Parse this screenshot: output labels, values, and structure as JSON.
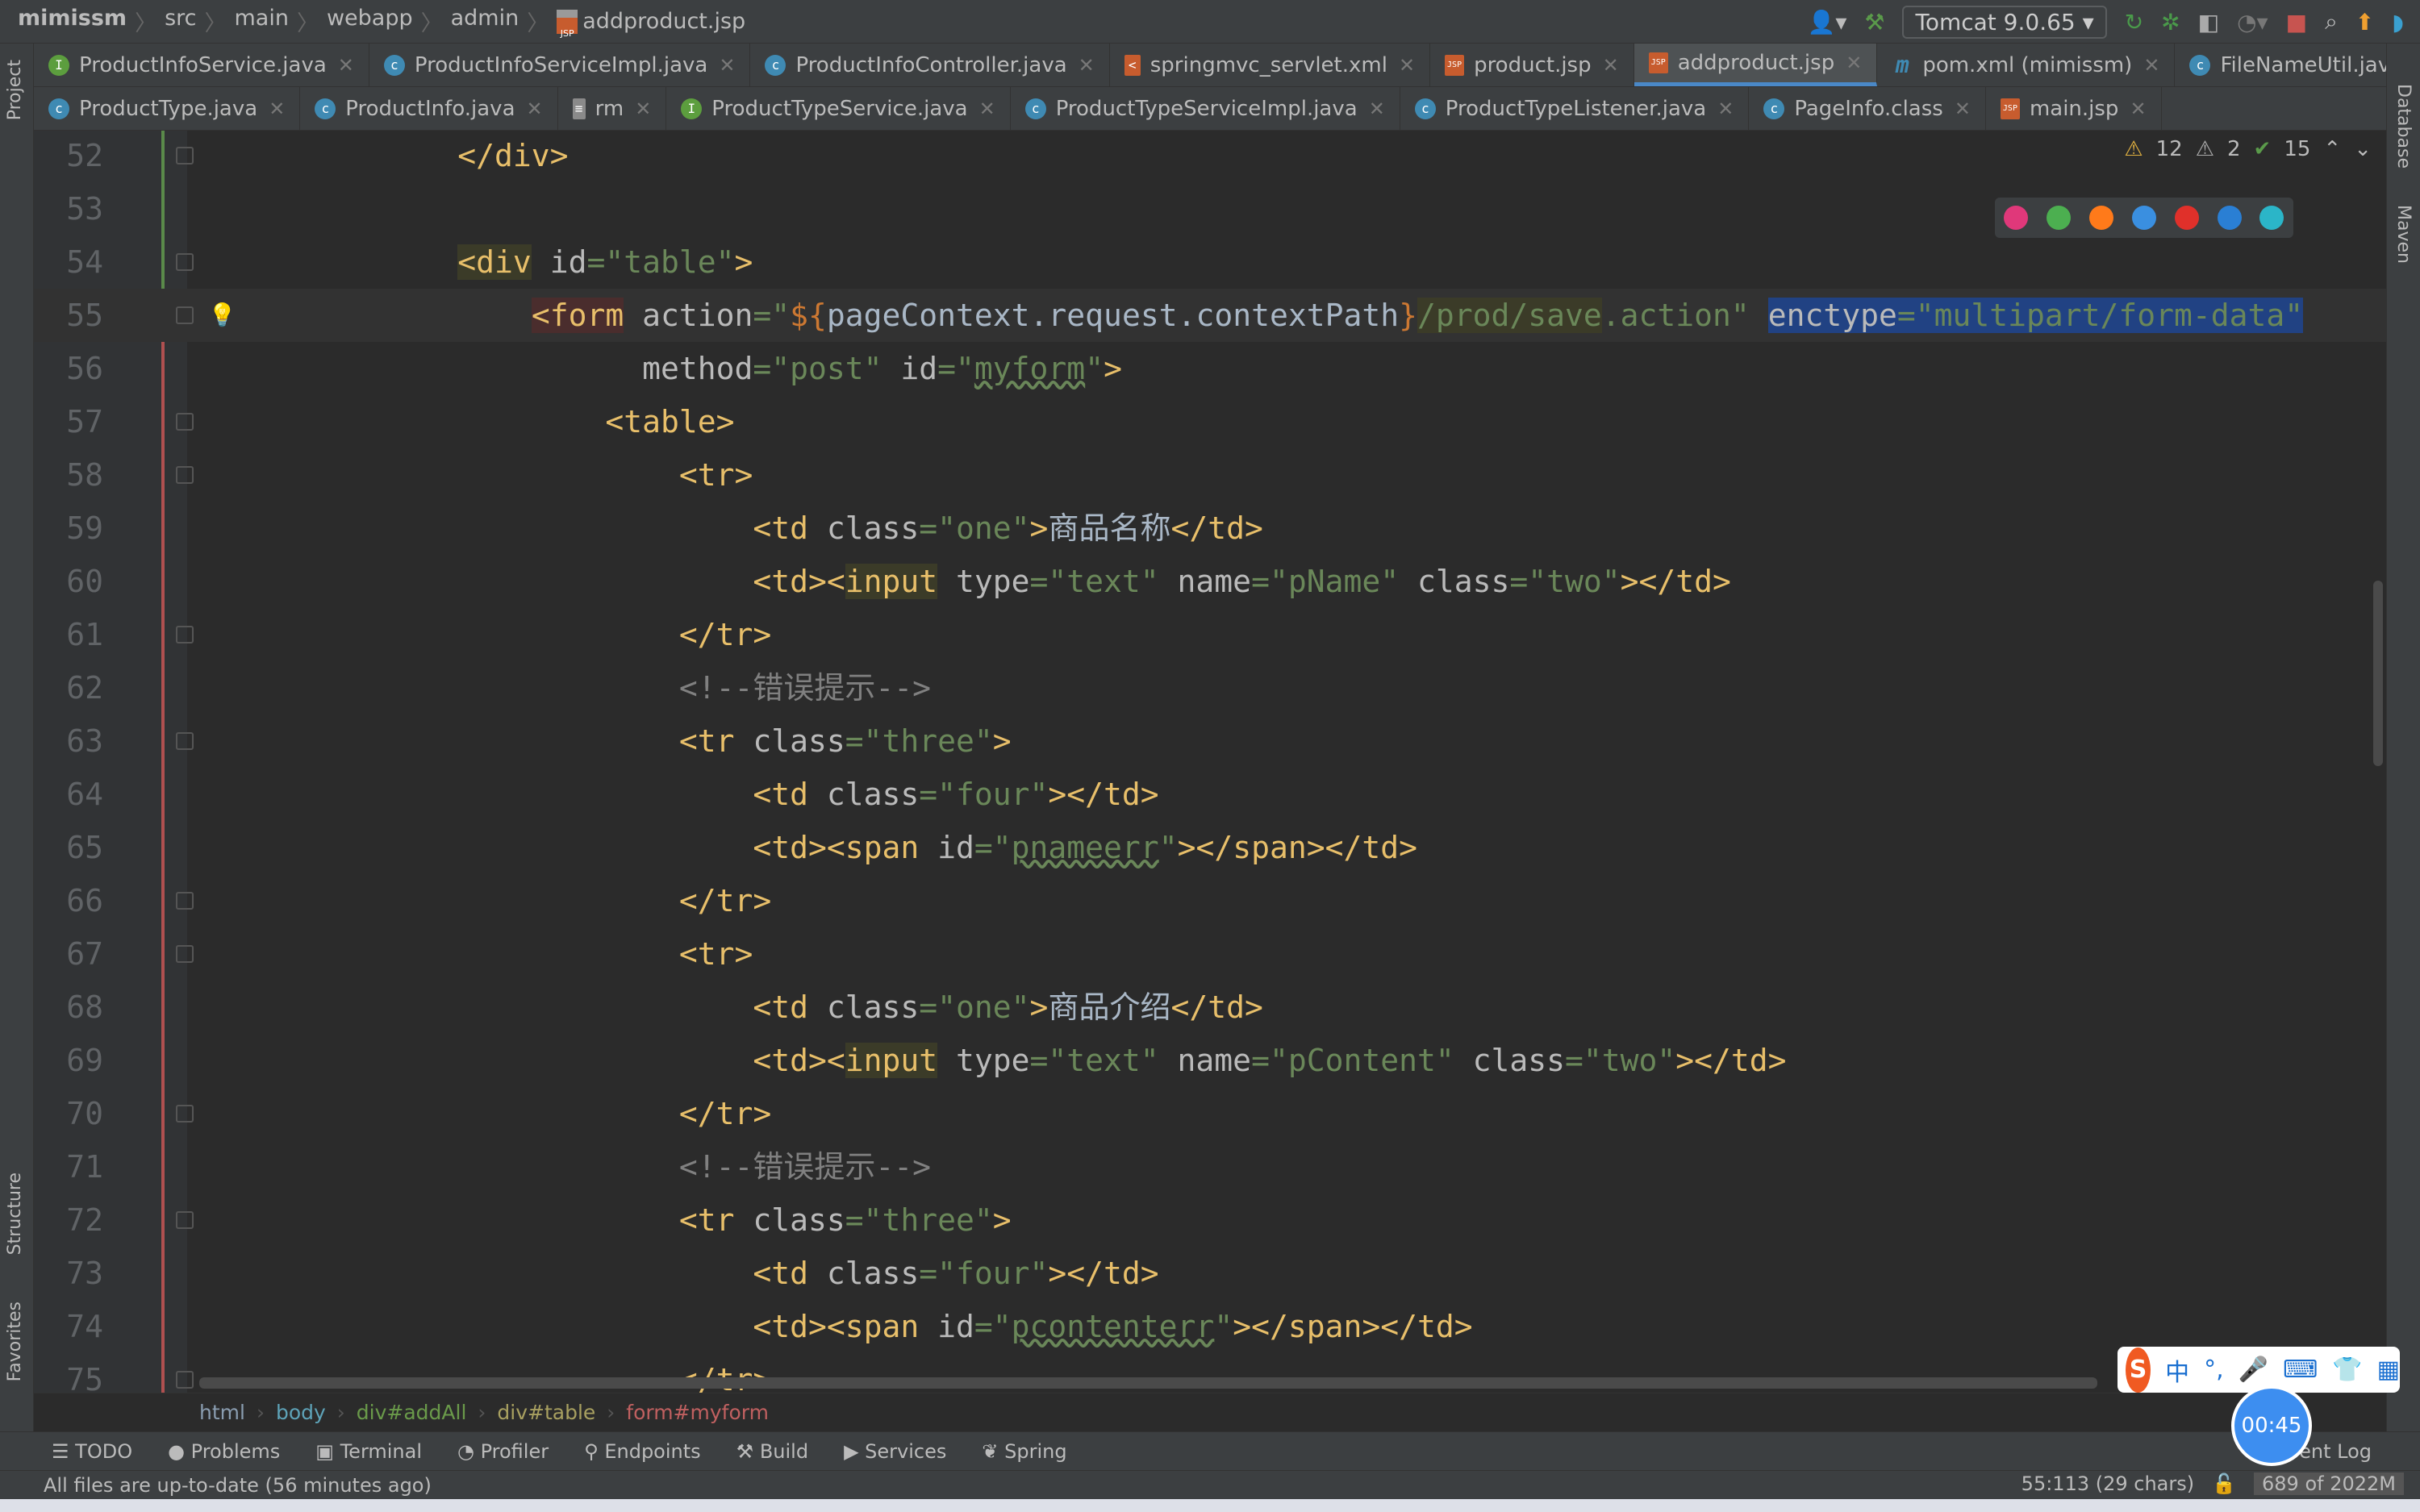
{
  "breadcrumb": {
    "items": [
      "mimissm",
      "src",
      "main",
      "webapp",
      "admin"
    ],
    "file": "addproduct.jsp"
  },
  "run": {
    "config": "Tomcat 9.0.65"
  },
  "tabs_row1": [
    {
      "label": "ProductInfoService.java",
      "icon": "I"
    },
    {
      "label": "ProductInfoServiceImpl.java",
      "icon": "C"
    },
    {
      "label": "ProductInfoController.java",
      "icon": "C"
    },
    {
      "label": "springmvc_servlet.xml",
      "icon": "X"
    },
    {
      "label": "product.jsp",
      "icon": "J"
    },
    {
      "label": "addproduct.jsp",
      "icon": "J",
      "active": true
    },
    {
      "label": "pom.xml (mimissm)",
      "icon": "M"
    },
    {
      "label": "FileNameUtil.java",
      "icon": "C"
    }
  ],
  "tabs_row2": [
    {
      "label": "ProductType.java",
      "icon": "C"
    },
    {
      "label": "ProductInfo.java",
      "icon": "C"
    },
    {
      "label": "rm",
      "icon": "F"
    },
    {
      "label": "ProductTypeService.java",
      "icon": "I"
    },
    {
      "label": "ProductTypeServiceImpl.java",
      "icon": "C"
    },
    {
      "label": "ProductTypeListener.java",
      "icon": "C"
    },
    {
      "label": "PageInfo.class",
      "icon": "C"
    },
    {
      "label": "main.jsp",
      "icon": "J"
    }
  ],
  "side": {
    "project": "Project",
    "structure": "Structure",
    "favorites": "Favorites",
    "database": "Database",
    "maven": "Maven"
  },
  "inspections": {
    "warnings": "12",
    "weak": "2",
    "ok": "15"
  },
  "code_lines": [
    {
      "n": "52",
      "indent": 12,
      "fold": true,
      "tokens": [
        [
          "t",
          "</div>"
        ]
      ]
    },
    {
      "n": "53",
      "indent": 0,
      "tokens": []
    },
    {
      "n": "54",
      "indent": 12,
      "fold": true,
      "tokens": [
        [
          "t ho",
          "<div"
        ],
        [
          "a",
          " id"
        ],
        [
          "s",
          "=\"table\""
        ],
        [
          "t",
          ">"
        ]
      ]
    },
    {
      "n": "55",
      "indent": 16,
      "fold": true,
      "current": true,
      "bulb": true,
      "tokens": [
        [
          "t hr",
          "<form"
        ],
        [
          "a",
          " action"
        ],
        [
          "s",
          "=\""
        ],
        [
          "e",
          "${"
        ],
        [
          "p",
          "pageContext.request.contextPath"
        ],
        [
          "e",
          "}"
        ],
        [
          "s ho",
          "/prod/save"
        ],
        [
          "s",
          ".action\""
        ],
        [
          "p",
          " "
        ],
        [
          "a hs",
          "enctype"
        ],
        [
          "s hs",
          "=\"multipart/form-data\""
        ]
      ]
    },
    {
      "n": "56",
      "indent": 22,
      "tokens": [
        [
          "a",
          "method"
        ],
        [
          "s",
          "=\"post\""
        ],
        [
          "a",
          " id"
        ],
        [
          "s",
          "=\""
        ],
        [
          "s wv",
          "myform"
        ],
        [
          "s",
          "\""
        ],
        [
          "t",
          ">"
        ]
      ]
    },
    {
      "n": "57",
      "indent": 20,
      "fold": true,
      "tokens": [
        [
          "t",
          "<table>"
        ]
      ]
    },
    {
      "n": "58",
      "indent": 24,
      "fold": true,
      "tokens": [
        [
          "t",
          "<tr>"
        ]
      ]
    },
    {
      "n": "59",
      "indent": 28,
      "tokens": [
        [
          "t",
          "<td"
        ],
        [
          "a",
          " class"
        ],
        [
          "s",
          "=\"one\""
        ],
        [
          "t",
          ">"
        ],
        [
          "p",
          "商品名称"
        ],
        [
          "t",
          "</td>"
        ]
      ]
    },
    {
      "n": "60",
      "indent": 28,
      "tokens": [
        [
          "t",
          "<td><"
        ],
        [
          "t ho",
          "input"
        ],
        [
          "a",
          " type"
        ],
        [
          "s",
          "=\"text\""
        ],
        [
          "a",
          " name"
        ],
        [
          "s",
          "=\"pName\""
        ],
        [
          "a",
          " class"
        ],
        [
          "s",
          "=\"two\""
        ],
        [
          "t",
          "></td>"
        ]
      ]
    },
    {
      "n": "61",
      "indent": 24,
      "fold": true,
      "tokens": [
        [
          "t",
          "</tr>"
        ]
      ]
    },
    {
      "n": "62",
      "indent": 24,
      "tokens": [
        [
          "c",
          "<!--错误提示-->"
        ]
      ]
    },
    {
      "n": "63",
      "indent": 24,
      "fold": true,
      "tokens": [
        [
          "t",
          "<tr"
        ],
        [
          "a",
          " class"
        ],
        [
          "s",
          "=\"three\""
        ],
        [
          "t",
          ">"
        ]
      ]
    },
    {
      "n": "64",
      "indent": 28,
      "tokens": [
        [
          "t",
          "<td"
        ],
        [
          "a",
          " class"
        ],
        [
          "s",
          "=\"four\""
        ],
        [
          "t",
          "></td>"
        ]
      ]
    },
    {
      "n": "65",
      "indent": 28,
      "tokens": [
        [
          "t",
          "<td><span"
        ],
        [
          "a",
          " id"
        ],
        [
          "s",
          "=\""
        ],
        [
          "s wv",
          "pnameerr"
        ],
        [
          "s",
          "\""
        ],
        [
          "t",
          "></span></td>"
        ]
      ]
    },
    {
      "n": "66",
      "indent": 24,
      "fold": true,
      "tokens": [
        [
          "t",
          "</tr>"
        ]
      ]
    },
    {
      "n": "67",
      "indent": 24,
      "fold": true,
      "tokens": [
        [
          "t",
          "<tr>"
        ]
      ]
    },
    {
      "n": "68",
      "indent": 28,
      "tokens": [
        [
          "t",
          "<td"
        ],
        [
          "a",
          " class"
        ],
        [
          "s",
          "=\"one\""
        ],
        [
          "t",
          ">"
        ],
        [
          "p",
          "商品介绍"
        ],
        [
          "t",
          "</td>"
        ]
      ]
    },
    {
      "n": "69",
      "indent": 28,
      "tokens": [
        [
          "t",
          "<td><"
        ],
        [
          "t ho",
          "input"
        ],
        [
          "a",
          " type"
        ],
        [
          "s",
          "=\"text\""
        ],
        [
          "a",
          " name"
        ],
        [
          "s",
          "=\"pContent\""
        ],
        [
          "a",
          " class"
        ],
        [
          "s",
          "=\"two\""
        ],
        [
          "t",
          "></td>"
        ]
      ]
    },
    {
      "n": "70",
      "indent": 24,
      "fold": true,
      "tokens": [
        [
          "t",
          "</tr>"
        ]
      ]
    },
    {
      "n": "71",
      "indent": 24,
      "tokens": [
        [
          "c",
          "<!--错误提示-->"
        ]
      ]
    },
    {
      "n": "72",
      "indent": 24,
      "fold": true,
      "tokens": [
        [
          "t",
          "<tr"
        ],
        [
          "a",
          " class"
        ],
        [
          "s",
          "=\"three\""
        ],
        [
          "t",
          ">"
        ]
      ]
    },
    {
      "n": "73",
      "indent": 28,
      "tokens": [
        [
          "t",
          "<td"
        ],
        [
          "a",
          " class"
        ],
        [
          "s",
          "=\"four\""
        ],
        [
          "t",
          "></td>"
        ]
      ]
    },
    {
      "n": "74",
      "indent": 28,
      "tokens": [
        [
          "t",
          "<td><span"
        ],
        [
          "a",
          " id"
        ],
        [
          "s",
          "=\""
        ],
        [
          "s wv",
          "pcontenterr"
        ],
        [
          "s",
          "\""
        ],
        [
          "t",
          "></span></td>"
        ]
      ]
    },
    {
      "n": "75",
      "indent": 24,
      "fold": true,
      "tokens": [
        [
          "t",
          "</tr>"
        ]
      ]
    }
  ],
  "path_crumbs": [
    {
      "label": "html",
      "color": "#8a9db0"
    },
    {
      "label": "body",
      "color": "#5ea3b8"
    },
    {
      "label": "div#addAll",
      "color": "#6a9a4a"
    },
    {
      "label": "div#table",
      "color": "#a8a060"
    },
    {
      "label": "form#myform",
      "color": "#c06060"
    }
  ],
  "toolwindows": [
    "TODO",
    "Problems",
    "Terminal",
    "Profiler",
    "Endpoints",
    "Build",
    "Services",
    "Spring"
  ],
  "event_log": "Event Log",
  "status": {
    "message": "All files are up-to-date (56 minutes ago)",
    "position": "55:113 (29 chars)",
    "memory": "689 of 2022M"
  },
  "ime": {
    "lang": "中"
  },
  "timer": "00:45",
  "browser_colors": [
    "#e0387a",
    "#4caf50",
    "#ff7a1a",
    "#3a8fe0",
    "#e0302a",
    "#2a7fd4",
    "#2bb5c8"
  ]
}
